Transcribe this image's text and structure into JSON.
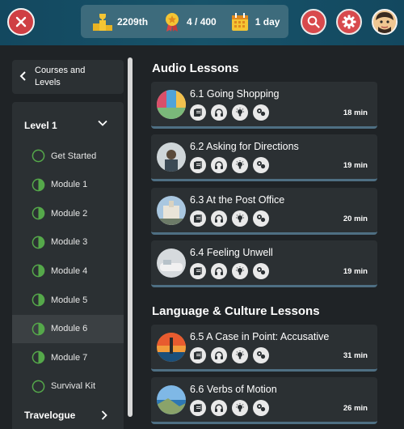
{
  "header": {
    "rank": "2209th",
    "stars": "4 / 400",
    "streak": "1 day"
  },
  "sidebar": {
    "courses_line1": "Courses and",
    "courses_line2": "Levels",
    "level_title": "Level 1",
    "items": [
      {
        "label": "Get Started",
        "progress": 0
      },
      {
        "label": "Module 1",
        "progress": 0.5
      },
      {
        "label": "Module 2",
        "progress": 0.5
      },
      {
        "label": "Module 3",
        "progress": 0.5
      },
      {
        "label": "Module 4",
        "progress": 0.5
      },
      {
        "label": "Module 5",
        "progress": 0.5
      },
      {
        "label": "Module 6",
        "progress": 0.5,
        "active": true
      },
      {
        "label": "Module 7",
        "progress": 0.5
      },
      {
        "label": "Survival Kit",
        "progress": 0
      }
    ],
    "travelogue": "Travelogue"
  },
  "main": {
    "audio_title": "Audio Lessons",
    "culture_title": "Language & Culture Lessons",
    "audio_lessons": [
      {
        "title": "6.1 Going Shopping",
        "duration": "18 min"
      },
      {
        "title": "6.2 Asking for Directions",
        "duration": "19 min"
      },
      {
        "title": "6.3 At the Post Office",
        "duration": "20 min"
      },
      {
        "title": "6.4 Feeling Unwell",
        "duration": "19 min"
      }
    ],
    "culture_lessons": [
      {
        "title": "6.5 A Case in Point: Accusative",
        "duration": "31 min"
      },
      {
        "title": "6.6 Verbs of Motion",
        "duration": "26 min"
      }
    ]
  },
  "colors": {
    "header_bg": "#17536a",
    "accent_red": "#d84a4d",
    "progress_green": "#55a84a",
    "card_bg": "#2b3033",
    "card_border": "#4e6f83"
  }
}
